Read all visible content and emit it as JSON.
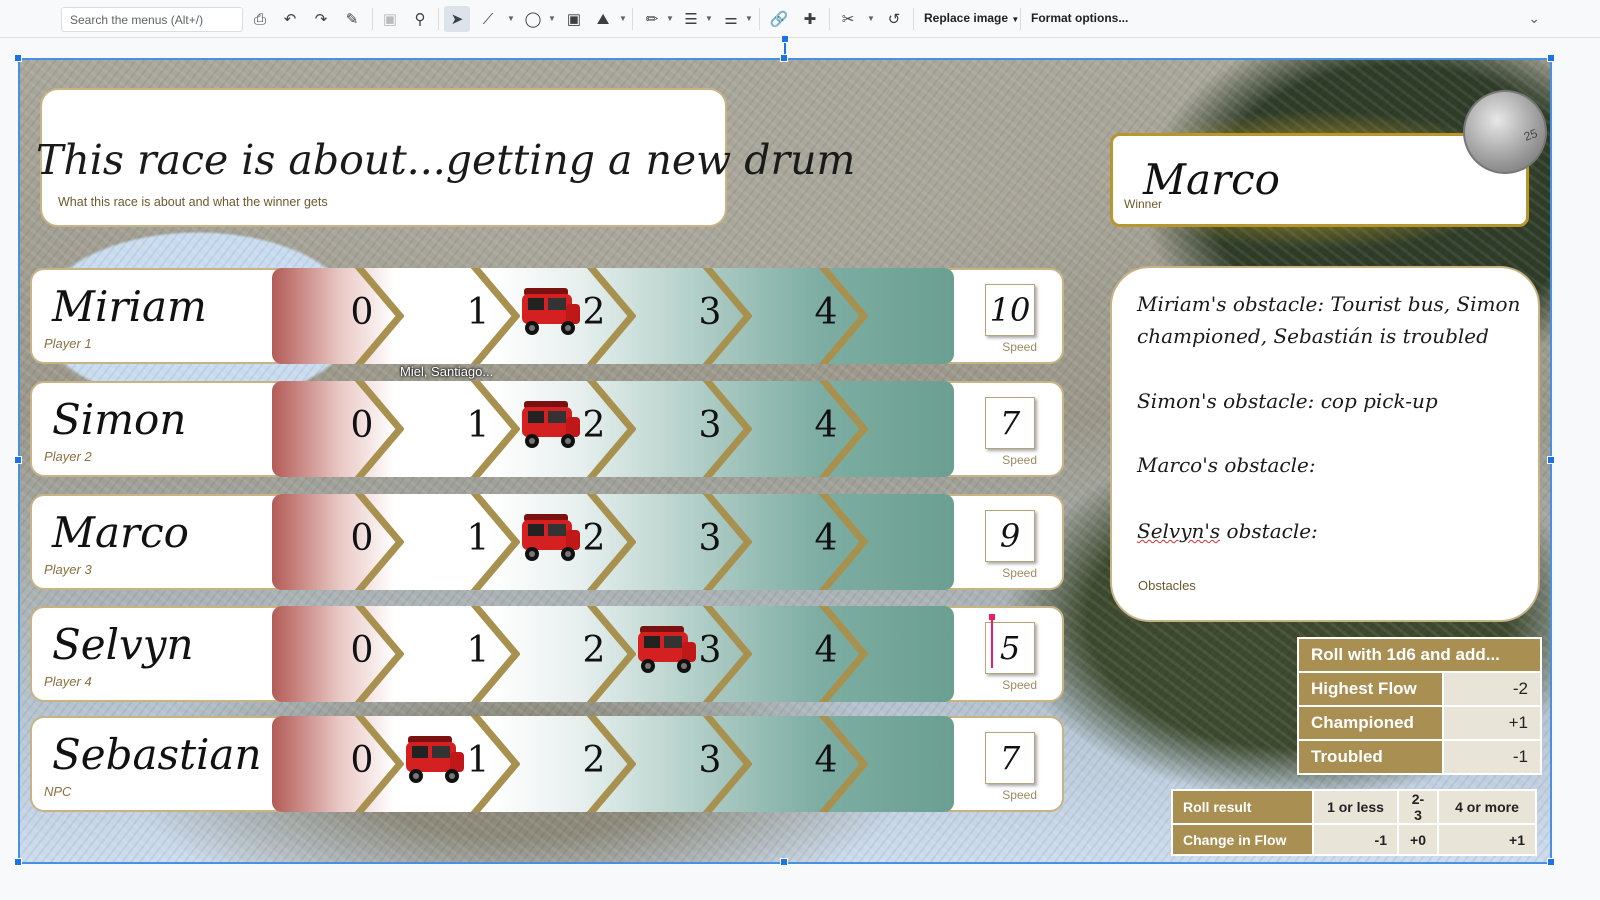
{
  "toolbar": {
    "search_placeholder": "Search the menus (Alt+/)",
    "replace_image": "Replace image",
    "format_options": "Format options..."
  },
  "title": {
    "text": "This race is about...getting a new drum",
    "caption": "What this race is about and what the winner gets"
  },
  "winner": {
    "name": "Marco",
    "label": "Winner",
    "coin_value": "25"
  },
  "map_label": "Miel, Santiago...",
  "track_numbers": [
    "0",
    "1",
    "2",
    "3",
    "4"
  ],
  "speed_label": "Speed",
  "racers": [
    {
      "name": "Miriam",
      "player": "Player 1",
      "speed": "10",
      "position": 2
    },
    {
      "name": "Simon",
      "player": "Player 2",
      "speed": "7",
      "position": 2
    },
    {
      "name": "Marco",
      "player": "Player 3",
      "speed": "9",
      "position": 2
    },
    {
      "name": "Selvyn",
      "player": "Player 4",
      "speed": "5",
      "position": 3
    },
    {
      "name": "Sebastian",
      "player": "NPC",
      "speed": "7",
      "position": 1
    }
  ],
  "obstacles": {
    "line1": "Miriam's obstacle: Tourist bus, Simon",
    "line2": "championed, Sebastián is troubled",
    "line3": "Simon's obstacle: cop pick-up",
    "line4": "Marco's obstacle:",
    "line5a": "Selvyn's",
    "line5b": " obstacle:",
    "caption": "Obstacles"
  },
  "roll_table": {
    "header": "Roll with 1d6 and add...",
    "rows": [
      {
        "label": "Highest Flow",
        "value": "-2"
      },
      {
        "label": "Championed",
        "value": "+1"
      },
      {
        "label": "Troubled",
        "value": "-1"
      }
    ]
  },
  "result_table": {
    "headers": [
      "Roll result",
      "1 or less",
      "2-3",
      "4 or more"
    ],
    "row": [
      "Change in Flow",
      "-1",
      "+0",
      "+1"
    ]
  },
  "colors": {
    "accent_gold": "#a98f52",
    "track_red": "#b25b56",
    "track_teal": "#6a9f91",
    "selection_blue": "#1a73e8"
  }
}
